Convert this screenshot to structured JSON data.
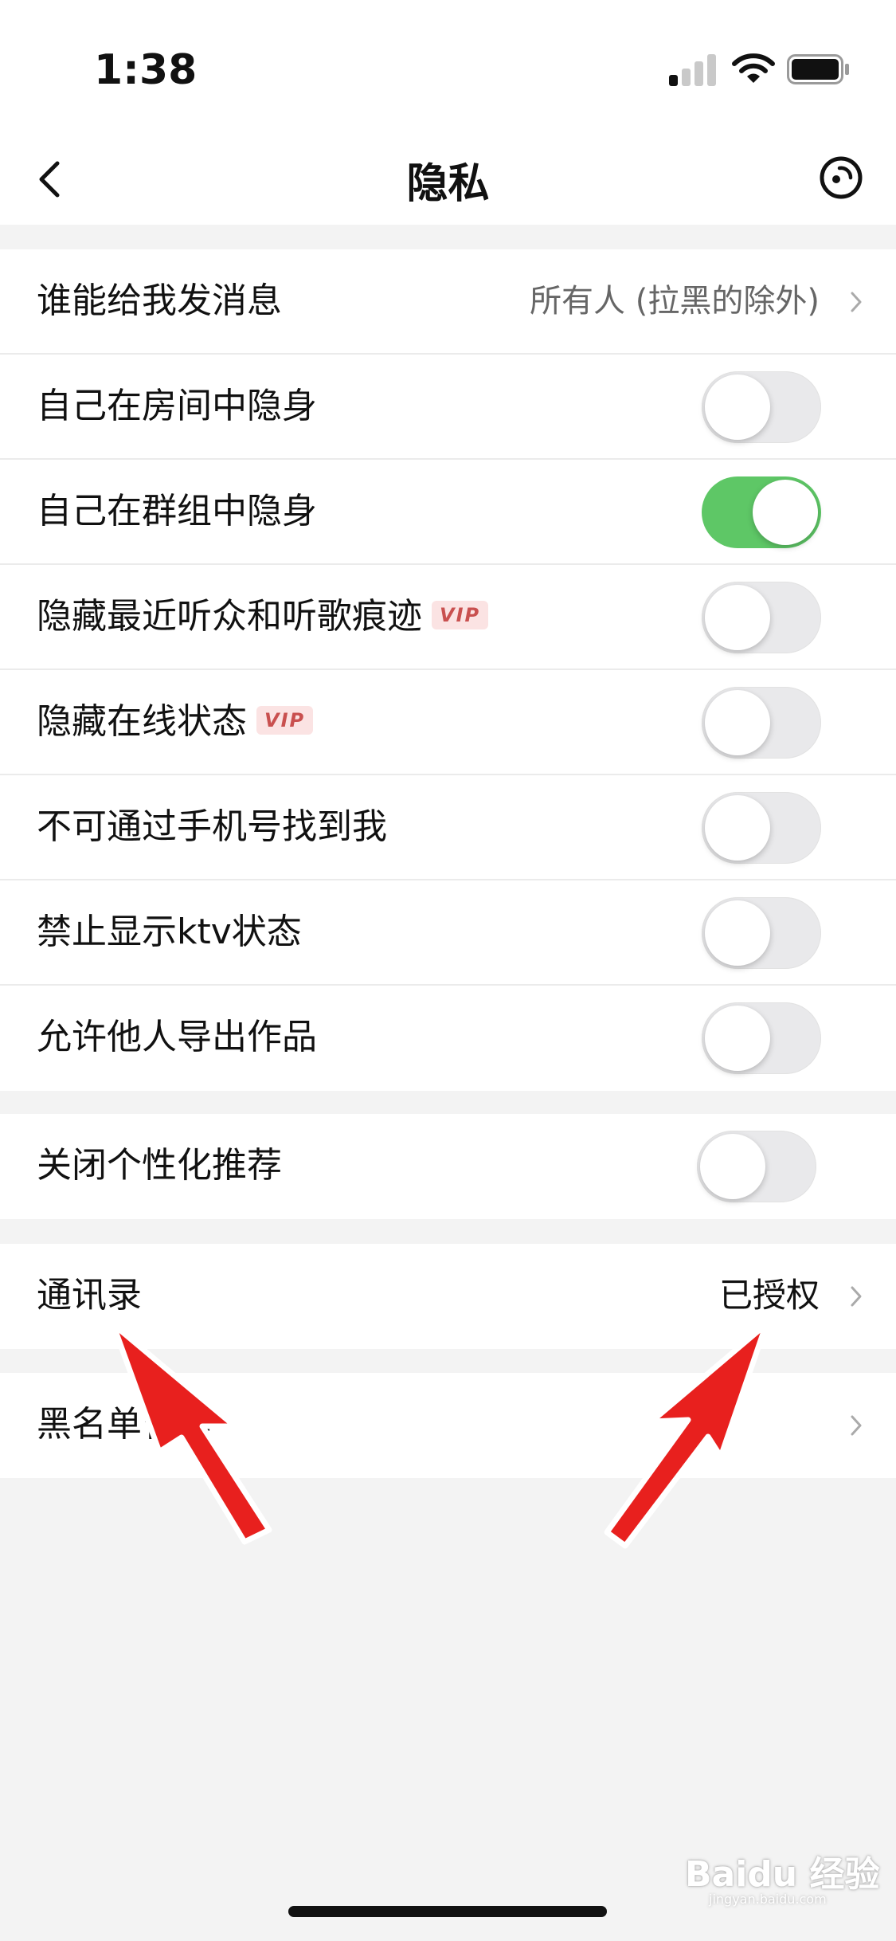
{
  "status_bar": {
    "time": "1:38",
    "signal_bars_active": 1
  },
  "nav": {
    "title": "隐私",
    "back_icon": "chevron-left-icon",
    "right_icon": "record-icon"
  },
  "groups": [
    {
      "rows": [
        {
          "label": "谁能给我发消息",
          "value": "所有人 (拉黑的除外)",
          "type": "link"
        },
        {
          "label": "自己在房间中隐身",
          "type": "toggle",
          "on": false
        },
        {
          "label": "自己在群组中隐身",
          "type": "toggle",
          "on": true
        },
        {
          "label": "隐藏最近听众和听歌痕迹",
          "badge": "VIP",
          "type": "toggle",
          "on": false
        },
        {
          "label": "隐藏在线状态",
          "badge": "VIP",
          "type": "toggle",
          "on": false
        },
        {
          "label": "不可通过手机号找到我",
          "type": "toggle",
          "on": false
        },
        {
          "label": "禁止显示ktv状态",
          "type": "toggle",
          "on": false
        },
        {
          "label": "允许他人导出作品",
          "type": "toggle",
          "on": false
        }
      ]
    },
    {
      "rows": [
        {
          "label": "关闭个性化推荐",
          "type": "toggle",
          "on": false
        }
      ]
    },
    {
      "rows": [
        {
          "label": "通讯录",
          "value": "已授权",
          "type": "link"
        }
      ]
    },
    {
      "rows": [
        {
          "label": "黑名单管理",
          "type": "link"
        }
      ]
    }
  ],
  "colors": {
    "toggle_on": "#5ec766",
    "toggle_off": "#e9e9eb",
    "vip_bg": "#fbe3e3",
    "vip_text": "#c9504f",
    "arrow": "#e8201e"
  },
  "watermark": {
    "text": "Baidu 经验",
    "sub": "jingyan.baidu.com"
  }
}
